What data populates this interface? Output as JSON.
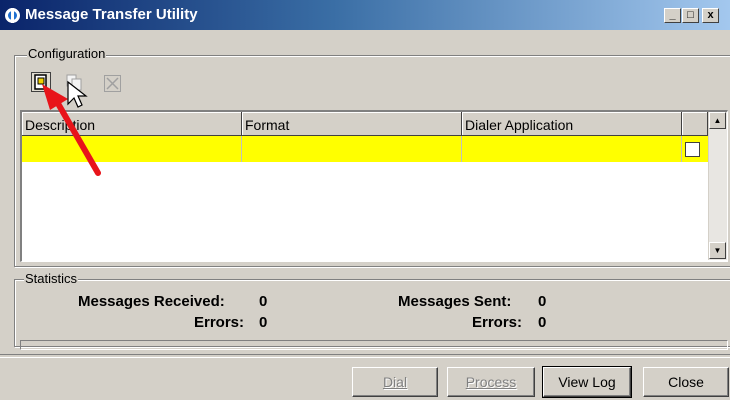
{
  "window": {
    "title": "Message Transfer Utility",
    "controls": {
      "minimize": "_",
      "maximize": "□",
      "close": "x"
    }
  },
  "configuration": {
    "group_label": "Configuration",
    "toolbar": [
      {
        "name": "new-config-icon",
        "enabled": true
      },
      {
        "name": "copy-config-icon",
        "enabled": false
      },
      {
        "name": "delete-config-icon",
        "enabled": false
      }
    ],
    "columns": [
      "Description",
      "Format",
      "Dialer Application"
    ],
    "rows": [
      {
        "description": "",
        "format": "",
        "dialer_application": "",
        "checked": false
      }
    ],
    "row_highlight": "#ffff00"
  },
  "statistics": {
    "group_label": "Statistics",
    "messages_received_label": "Messages Received:",
    "messages_received": "0",
    "received_errors_label": "Errors:",
    "received_errors": "0",
    "messages_sent_label": "Messages Sent:",
    "messages_sent": "0",
    "sent_errors_label": "Errors:",
    "sent_errors": "0"
  },
  "buttons": {
    "dial": {
      "label": "Dial",
      "enabled": false
    },
    "process": {
      "label": "Process",
      "enabled": false
    },
    "view_log": {
      "label": "View Log",
      "enabled": true
    },
    "close": {
      "label": "Close",
      "enabled": true
    }
  },
  "annotation": {
    "arrow_color": "#e8141a"
  },
  "colors": {
    "titlebar_start": "#0a246a",
    "titlebar_end": "#a6caf0",
    "face": "#d4d0c8"
  }
}
